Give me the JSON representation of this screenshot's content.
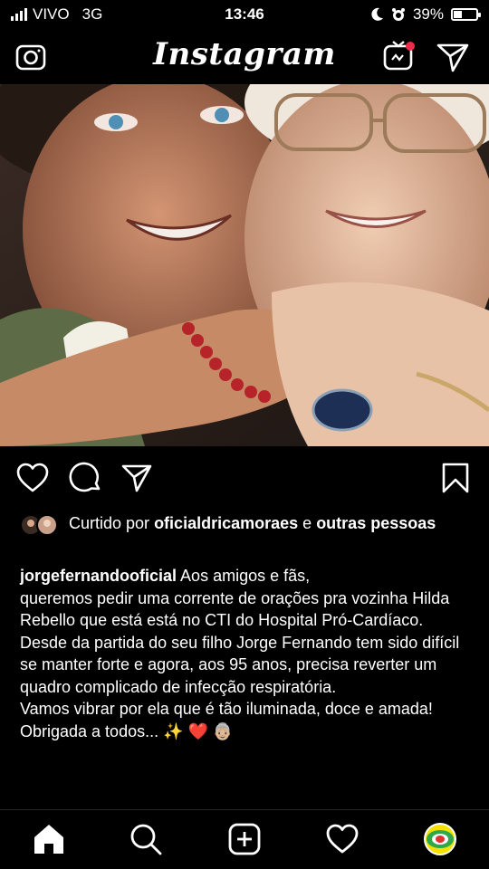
{
  "status_bar": {
    "carrier": "VIVO",
    "network": "3G",
    "time": "13:46",
    "battery": "39%",
    "battery_level": 0.39
  },
  "header": {
    "brand": "Instagram",
    "camera_icon": "camera-icon",
    "igtv_icon": "igtv-icon",
    "direct_icon": "paper-plane-icon"
  },
  "post": {
    "image_description_icon": "photo",
    "actions": {
      "like_icon": "heart-icon",
      "comment_icon": "comment-icon",
      "share_icon": "paper-plane-icon",
      "save_icon": "bookmark-icon"
    },
    "likes": {
      "prefix": "Curtido por",
      "user": "oficialdricamoraes",
      "conjunction": "e",
      "others": "outras pessoas"
    },
    "caption": {
      "username": "jorgefernandooficial",
      "line1": "Aos amigos e fãs,",
      "line2": "queremos pedir uma corrente de orações pra vozinha Hilda Rebello que está está no CTI do Hospital Pró-Cardíaco.",
      "line3": "Desde da partida do seu filho Jorge Fernando tem sido difícil se manter forte e agora, aos 95 anos, precisa reverter um quadro complicado de infecção respiratória.",
      "line4": "Vamos vibrar por ela que é tão iluminada, doce e amada!",
      "line5": "Obrigada a todos... ✨ ❤️ 👵🏼"
    }
  },
  "tab_bar": {
    "items": [
      "home-icon",
      "search-icon",
      "add-post-icon",
      "activity-heart-icon",
      "profile-avatar"
    ]
  }
}
